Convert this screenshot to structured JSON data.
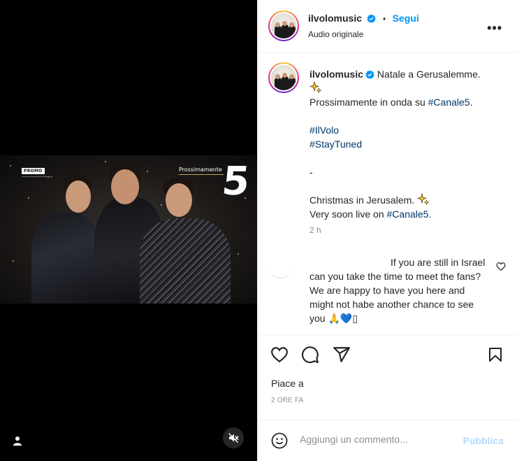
{
  "post": {
    "username": "ilvolomusic",
    "follow_label": "Segui",
    "separator": "•",
    "audio_label": "Audio originale",
    "more_label": "•••"
  },
  "video": {
    "promo_tag": "PROMO",
    "overlay_text": "Prossimamente",
    "channel_logo": "5"
  },
  "caption": {
    "username": "ilvolomusic",
    "line1": "Natale a Gerusalemme.",
    "line2_prefix": "Prossimamente in onda su ",
    "line2_tag": "#Canale5",
    "line2_suffix": ".",
    "tag1": "#IlVolo",
    "tag2": "#StayTuned",
    "dash": "-",
    "line3": "Christmas in Jerusalem.",
    "line4_prefix": "Very soon live on ",
    "line4_tag": "#Canale5",
    "line4_suffix": ".",
    "time_ago": "2 h"
  },
  "comment": {
    "text": "If you are still in Israel can you take the time to meet the fans? We are happy to have you here and might not habe another chance to see you 🙏💙▯"
  },
  "footer": {
    "likes_label": "Piace a",
    "posted_time": "2 ORE FA",
    "comment_placeholder": "Aggiungi un commento...",
    "publish_label": "Pubblica"
  },
  "icons": {
    "verified": "verified-badge-icon",
    "sparkles": "sparkles-icon",
    "heart": "heart-icon",
    "comment": "comment-bubble-icon",
    "share": "paper-plane-icon",
    "save": "bookmark-icon",
    "emoji": "smiley-icon",
    "mute": "speaker-muted-icon",
    "user": "user-tag-icon"
  },
  "colors": {
    "accent": "#0095f6",
    "hashtag": "#00376b",
    "muted": "#8e8e8e",
    "publish_disabled": "#b3dbff"
  }
}
